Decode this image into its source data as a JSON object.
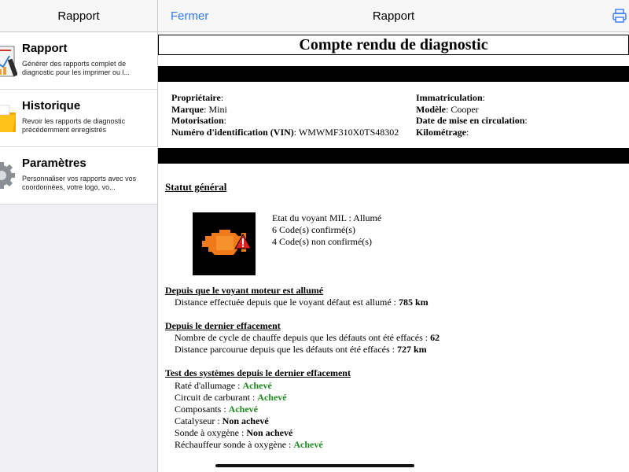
{
  "sidebar": {
    "title": "Rapport",
    "items": [
      {
        "title": "Rapport",
        "desc": "Générer des rapports complet de diagnostic pour les imprimer ou l...",
        "icon": "report-icon"
      },
      {
        "title": "Historique",
        "desc": "Revoir les rapports de diagnostic précédemment enregistrés",
        "icon": "folder-icon"
      },
      {
        "title": "Paramètres",
        "desc": "Personnaliser vos rapports avec vos coordonnées, votre logo, vo...",
        "icon": "gear-icon"
      }
    ]
  },
  "navbar": {
    "close_label": "Fermer",
    "title": "Rapport",
    "print_icon": "printer-icon"
  },
  "report": {
    "title": "Compte rendu de diagnostic",
    "vehicle": {
      "owner_label": "Propriétaire",
      "owner_value": "",
      "brand_label": "Marque",
      "brand_value": "Mini",
      "engine_label": "Motorisation",
      "engine_value": "",
      "vin_label": "Numéro d'identification (VIN)",
      "vin_value": "WMWMF310X0TS48302",
      "plate_label": "Immatriculation",
      "plate_value": "",
      "model_label": "Modèle",
      "model_value": "Cooper",
      "date_label": "Date de mise en circulation",
      "date_value": "",
      "mileage_label": "Kilométrage",
      "mileage_value": ""
    },
    "status": {
      "title": "Statut général",
      "mil_state": "Etat du voyant MIL : Allumé",
      "confirmed": "6 Code(s) confirmé(s)",
      "unconfirmed": "4 Code(s) non confirmé(s)",
      "engine_icon": "check-engine-warning-icon"
    },
    "since_mil": {
      "title": "Depuis que le voyant moteur est allumé",
      "distance_label": "Distance effectuée depuis que le voyant défaut est allumé : ",
      "distance_value": "785 km"
    },
    "since_clear": {
      "title": "Depuis le dernier effacement",
      "warmup_label": "Nombre de cycle de chauffe depuis que les défauts ont été effacés : ",
      "warmup_value": "62",
      "distance_label": "Distance parcourue depuis que les défauts ont été effacés : ",
      "distance_value": "727 km"
    },
    "tests": {
      "title": "Test des systèmes depuis le dernier effacement",
      "items": [
        {
          "label": "Raté d'allumage : ",
          "value": "Achevé",
          "ok": true
        },
        {
          "label": "Circuit de carburant : ",
          "value": "Achevé",
          "ok": true
        },
        {
          "label": "Composants : ",
          "value": "Achevé",
          "ok": true
        },
        {
          "label": "Catalyseur : ",
          "value": "Non achevé",
          "ok": false
        },
        {
          "label": "Sonde à oxygène : ",
          "value": "Non achevé",
          "ok": false
        },
        {
          "label": "Réchauffeur sonde à oxygène : ",
          "value": "Achevé",
          "ok": true
        }
      ]
    }
  },
  "colors": {
    "accent": "#3478f6",
    "ok_green": "#1e8a1e",
    "engine_orange": "#f07a1a",
    "warning_red": "#e02020"
  }
}
